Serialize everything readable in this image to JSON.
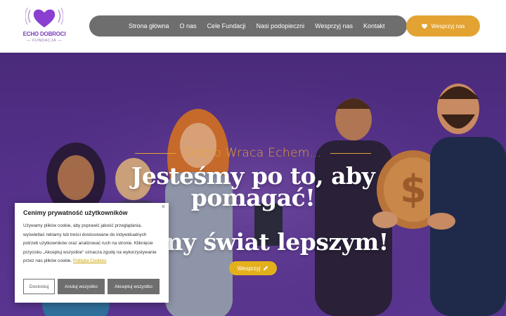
{
  "brand": {
    "name": "ECHO DOBROCI",
    "subtitle": "— FUNDACJA —",
    "colors": {
      "purple": "#7a3cb8",
      "gold": "#e3a332",
      "nav_gray": "#6e6e6e"
    }
  },
  "nav": {
    "items": [
      {
        "label": "Strona główna"
      },
      {
        "label": "O nas"
      },
      {
        "label": "Cele Fundacji"
      },
      {
        "label": "Nasi podopieczni"
      },
      {
        "label": "Wesprzyj nas"
      },
      {
        "label": "Kontakt"
      }
    ]
  },
  "header_cta": {
    "label": "Wesprzyj nas",
    "icon": "heart-icon"
  },
  "hero": {
    "tagline": "Dobro Wraca Echem...",
    "title_line1": "Jesteśmy po to, aby",
    "title_line2": "pomagać!",
    "title_line3": "zmy świat lepszym!",
    "button_label": "Wesprzyj",
    "button_icon": "pencil-icon"
  },
  "cookie": {
    "title": "Cenimy prywatność użytkowników",
    "text": "Używamy plików cookie, aby poprawić jakość przeglądania, wyświetlać reklamy lub treści dostosowane do indywidualnych potrzeb użytkowników oraz analizować ruch na stronie. Kliknięcie przycisku „Akceptuj wszystkie” oznacza zgodę na wykorzystywanie przez nas plików cookie.",
    "link": "Polityka Cookies",
    "close": "×",
    "buttons": {
      "settings": "Dostostuj",
      "reject": "Anuluj wszystko",
      "accept": "Akceptuj wszystko"
    }
  }
}
